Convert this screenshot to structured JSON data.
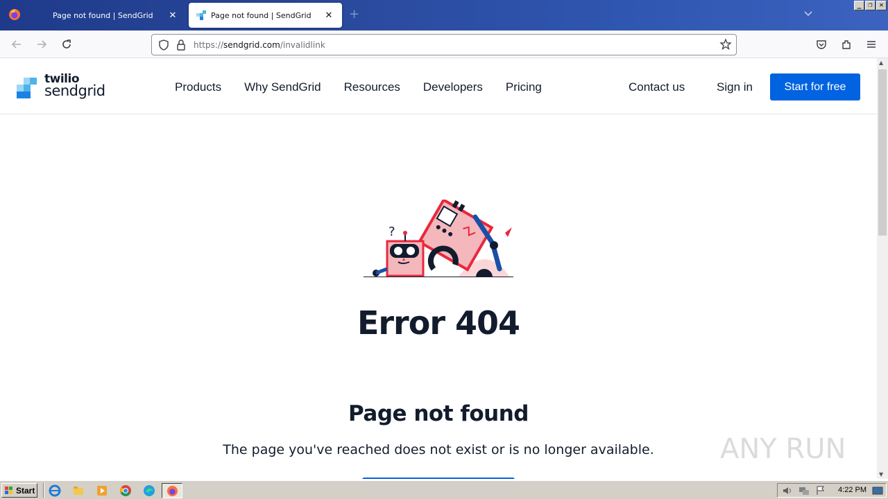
{
  "browser": {
    "tabs": [
      {
        "title": "Page not found | SendGrid",
        "active": false
      },
      {
        "title": "Page not found | SendGrid",
        "active": true
      }
    ],
    "url_prefix": "https://",
    "url_host": "sendgrid.com",
    "url_path": "/invalidlink"
  },
  "site": {
    "logo_line1": "twilio",
    "logo_line2": "sendgrid",
    "nav": [
      "Products",
      "Why SendGrid",
      "Resources",
      "Developers",
      "Pricing"
    ],
    "contact": "Contact us",
    "signin": "Sign in",
    "cta": "Start for free",
    "brand_color": "#0263e0"
  },
  "content": {
    "error_title": "Error 404",
    "heading": "Page not found",
    "description": "The page you've reached does not exist or is no longer available."
  },
  "watermark": "ANY RUN",
  "taskbar": {
    "start_label": "Start",
    "clock": "4:22 PM"
  }
}
